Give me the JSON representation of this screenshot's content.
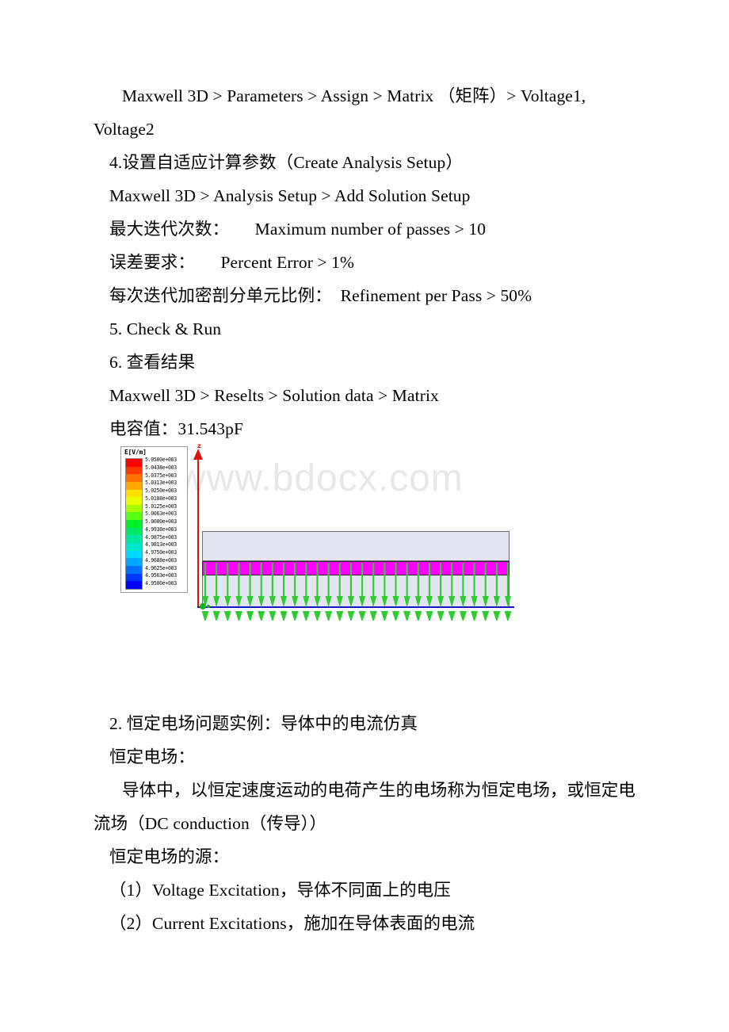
{
  "document": {
    "type": "technical-tutorial-page",
    "language": "zh-CN",
    "watermark": "www.bdocx.com",
    "paragraphs": [
      {
        "id": "p1",
        "text": "Maxwell 3D > Parameters > Assign > Matrix （矩阵）> Voltage1, Voltage2"
      },
      {
        "id": "p2",
        "text": "4.设置自适应计算参数（Create Analysis Setup）"
      },
      {
        "id": "p3",
        "text": "Maxwell 3D > Analysis Setup > Add Solution Setup"
      },
      {
        "id": "p4",
        "text": "最大迭代次数：　　Maximum number of passes > 10"
      },
      {
        "id": "p5",
        "text": "误差要求：　　Percent Error > 1%"
      },
      {
        "id": "p6",
        "text": "每次迭代加密剖分单元比例：　Refinement per Pass > 50%"
      },
      {
        "id": "p7",
        "text": "5. Check & Run"
      },
      {
        "id": "p8",
        "text": "6. 查看结果"
      },
      {
        "id": "p9",
        "text": "Maxwell 3D > Reselts > Solution data > Matrix"
      },
      {
        "id": "p10",
        "text": "电容值：31.543pF"
      },
      {
        "id": "p11",
        "text": "2. 恒定电场问题实例：导体中的电流仿真"
      },
      {
        "id": "p12",
        "text": "恒定电场："
      },
      {
        "id": "p13",
        "text": "导体中，以恒定速度运动的电荷产生的电场称为恒定电场，或恒定电流场（DC conduction（传导））"
      },
      {
        "id": "p14",
        "text": "恒定电场的源："
      },
      {
        "id": "p15",
        "text": "（1）Voltage Excitation，导体不同面上的电压"
      },
      {
        "id": "p16",
        "text": "（2）Current Excitations，施加在导体表面的电流"
      }
    ]
  },
  "figure": {
    "name": "maxwell-3d-e-field-plot",
    "legend_title": "E[V/m]",
    "axis_z_label": "z",
    "legend_labels": [
      "5.0500e+003",
      "5.0438e+003",
      "5.0375e+003",
      "5.0313e+003",
      "5.0250e+003",
      "5.0188e+003",
      "5.0125e+003",
      "5.0063e+003",
      "5.0000e+003",
      "4.9938e+003",
      "4.9875e+003",
      "4.9813e+003",
      "4.9750e+003",
      "4.9688e+003",
      "4.9625e+003",
      "4.9563e+003",
      "4.9500e+003"
    ],
    "legend_colors": [
      "#ff0000",
      "#ff3800",
      "#ff7000",
      "#ffa800",
      "#ffe000",
      "#e8ff00",
      "#a8ff00",
      "#58ff10",
      "#00f028",
      "#00e868",
      "#00e8a0",
      "#00e8d0",
      "#00d8ff",
      "#00a8ff",
      "#0070ff",
      "#0038ff",
      "#0000ff"
    ],
    "geometry_colors": {
      "dielectric": "#e2e4ef",
      "conductor": "#ff00ff",
      "z_axis": "#e01010",
      "x_axis": "#1414c8",
      "field_arrow": "#2ecc2e"
    },
    "arrow_count": 28
  }
}
